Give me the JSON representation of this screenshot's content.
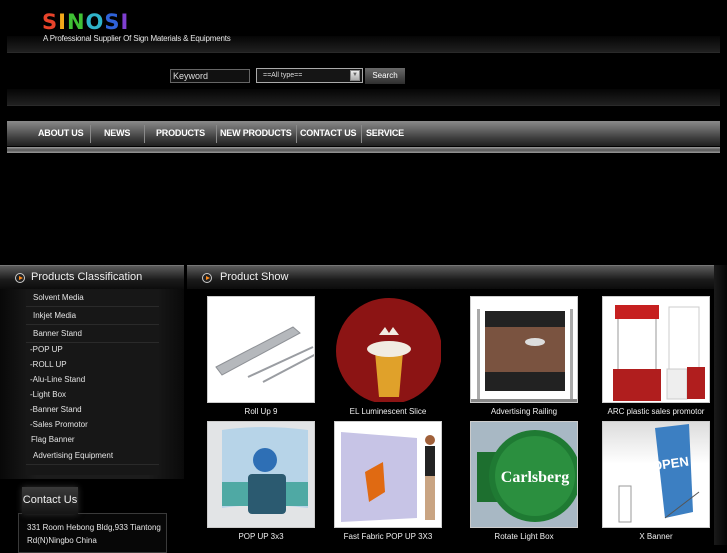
{
  "header": {
    "logo_letters": [
      {
        "ch": "S",
        "color": "#e8432a"
      },
      {
        "ch": "I",
        "color": "#f2a81a"
      },
      {
        "ch": "N",
        "color": "#3fbf34"
      },
      {
        "ch": "O",
        "color": "#2fb3c9"
      },
      {
        "ch": "S",
        "color": "#2f62d9"
      },
      {
        "ch": "I",
        "color": "#7f3fd0"
      }
    ],
    "tagline": "A Professional Supplier Of Sign Materials & Equipments"
  },
  "search": {
    "keyword_placeholder": "Keyword",
    "type_selected": "==All type==",
    "search_label": "Search"
  },
  "nav": {
    "items": [
      "ABOUT US",
      "NEWS",
      "PRODUCTS",
      "NEW PRODUCTS",
      "CONTACT US",
      "SERVICE"
    ]
  },
  "sidebar": {
    "title": "Products  Classification",
    "categories": [
      {
        "label": "Solvent Media",
        "kind": "major"
      },
      {
        "label": "Inkjet Media",
        "kind": "major"
      },
      {
        "label": "Banner Stand",
        "kind": "major"
      },
      {
        "label": "-POP UP",
        "kind": "sub"
      },
      {
        "label": "-ROLL UP",
        "kind": "sub"
      },
      {
        "label": "-Alu-Line Stand",
        "kind": "sub"
      },
      {
        "label": "-Light Box",
        "kind": "sub"
      },
      {
        "label": "-Banner Stand",
        "kind": "sub"
      },
      {
        "label": "-Sales Promotor",
        "kind": "sub"
      },
      {
        "label": "Flag Banner",
        "kind": "plain"
      },
      {
        "label": "Advertising Equipment",
        "kind": "major"
      }
    ]
  },
  "contact": {
    "title": "Contact Us",
    "address_line1": "331 Room Hebong Bldg,933 Tiantong",
    "address_line2": "Rd(N)Ningbo China"
  },
  "product_show": {
    "title": "Product Show",
    "products": [
      {
        "name": "Roll Up 9",
        "image": "roll-up-stand-image"
      },
      {
        "name": "EL Luminescent Slice",
        "image": "beer-glass-circle-image"
      },
      {
        "name": "Advertising Railing",
        "image": "railing-display-image"
      },
      {
        "name": "ARC plastic sales promotor",
        "image": "promotion-counter-image"
      },
      {
        "name": "POP UP 3x3",
        "image": "pop-up-display-image"
      },
      {
        "name": "Fast Fabric POP UP 3X3",
        "image": "fabric-butterfly-display-image"
      },
      {
        "name": "Rotate Light Box",
        "image": "carlsberg-light-box-image"
      },
      {
        "name": "X Banner",
        "image": "x-banner-open-image"
      }
    ]
  }
}
